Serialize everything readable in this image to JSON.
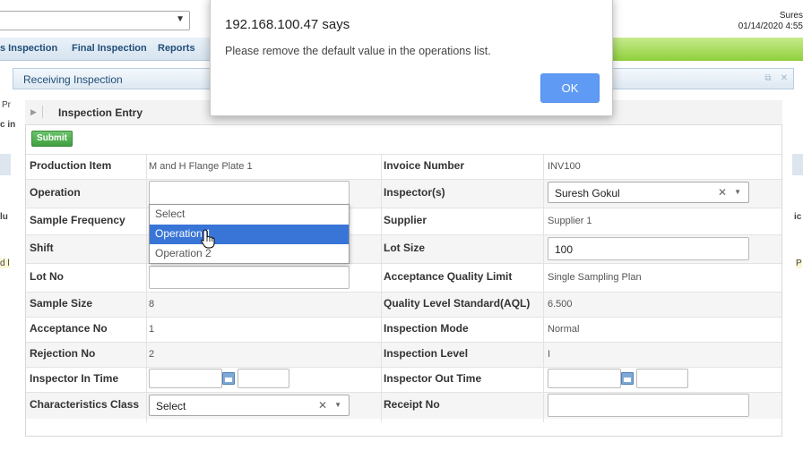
{
  "header": {
    "user_name": "Sures",
    "datetime": "01/14/2020 4:55"
  },
  "nav": {
    "items": [
      "s Inspection",
      "Final Inspection",
      "Reports"
    ]
  },
  "panel": {
    "title": "Receiving Inspection"
  },
  "left_sliver": [
    "Pr",
    "c in",
    "lu",
    "d l"
  ],
  "right_sliver": [
    "ic",
    "P"
  ],
  "entry": {
    "title": "Inspection Entry",
    "submit_label": "Submit",
    "left": {
      "production_item": {
        "label": "Production Item",
        "value": "M and H Flange Plate 1"
      },
      "operation": {
        "label": "Operation",
        "value": ""
      },
      "sample_frequency": {
        "label": "Sample Frequency"
      },
      "shift": {
        "label": "Shift"
      },
      "lot_no": {
        "label": "Lot No",
        "value": ""
      },
      "sample_size": {
        "label": "Sample Size",
        "value": "8"
      },
      "acceptance_no": {
        "label": "Acceptance No",
        "value": "1"
      },
      "rejection_no": {
        "label": "Rejection No",
        "value": "2"
      },
      "inspector_in_time": {
        "label": "Inspector In Time"
      },
      "characteristics_class": {
        "label": "Characteristics Class",
        "value": "Select"
      }
    },
    "right": {
      "invoice_number": {
        "label": "Invoice Number",
        "value": "INV100"
      },
      "inspectors": {
        "label": "Inspector(s)",
        "value": "Suresh Gokul"
      },
      "supplier": {
        "label": "Supplier",
        "value": "Supplier 1"
      },
      "lot_size": {
        "label": "Lot Size",
        "value": "100"
      },
      "aql": {
        "label": "Acceptance Quality Limit",
        "value": "Single Sampling Plan"
      },
      "quality_level": {
        "label": "Quality Level Standard(AQL)",
        "value": "6.500"
      },
      "inspection_mode": {
        "label": "Inspection Mode",
        "value": "Normal"
      },
      "inspection_level": {
        "label": "Inspection Level",
        "value": "I"
      },
      "inspector_out_time": {
        "label": "Inspector Out Time"
      },
      "receipt_no": {
        "label": "Receipt No",
        "value": ""
      }
    }
  },
  "operation_dropdown": {
    "options": [
      "Select",
      "Operation 1",
      "Operation 2"
    ],
    "highlighted": "Operation 1"
  },
  "alert": {
    "title": "192.168.100.47 says",
    "message": "Please remove the default value in the operations list.",
    "ok_label": "OK"
  },
  "colors": {
    "accent": "#3875d7",
    "ok_button": "#5f9bf5",
    "submit": "#4caf50",
    "nav_green": "#8fcf3c"
  }
}
